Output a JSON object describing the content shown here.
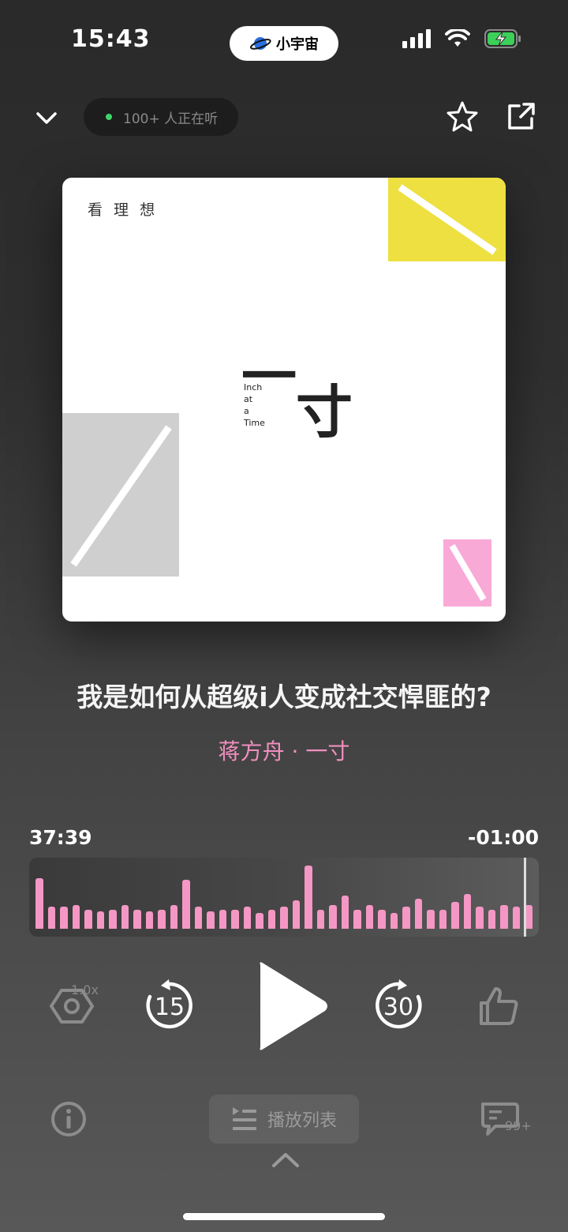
{
  "status_bar": {
    "time": "15:43",
    "app_pill": "小宇宙"
  },
  "header": {
    "listeners_label": "100+ 人正在听"
  },
  "cover": {
    "brand": "看 理 想",
    "big_char_1": "一",
    "big_char_2": "寸",
    "english_lines": [
      "Inch",
      "at",
      "a",
      "Time"
    ],
    "colors": {
      "yellow": "#ede040",
      "gray": "#cfcfcf",
      "pink": "#f8a9d6"
    }
  },
  "episode": {
    "title": "我是如何从超级i人变成社交悍匪的?",
    "subtitle": "蒋方舟 · 一寸"
  },
  "progress": {
    "elapsed": "37:39",
    "remaining": "-01:00",
    "waveform_levels": [
      0.8,
      0.35,
      0.35,
      0.38,
      0.3,
      0.28,
      0.3,
      0.38,
      0.3,
      0.28,
      0.3,
      0.38,
      0.78,
      0.35,
      0.28,
      0.3,
      0.3,
      0.35,
      0.25,
      0.3,
      0.35,
      0.45,
      1.0,
      0.3,
      0.38,
      0.52,
      0.3,
      0.38,
      0.3,
      0.25,
      0.35,
      0.48,
      0.3,
      0.3,
      0.42,
      0.55,
      0.35,
      0.3,
      0.38,
      0.35,
      0.38
    ],
    "accent": "#f497c4"
  },
  "controls": {
    "speed_label": "1.0x",
    "back_seconds": "15",
    "forward_seconds": "30"
  },
  "bottom": {
    "playlist_label": "播放列表",
    "comments_count": "99+"
  }
}
